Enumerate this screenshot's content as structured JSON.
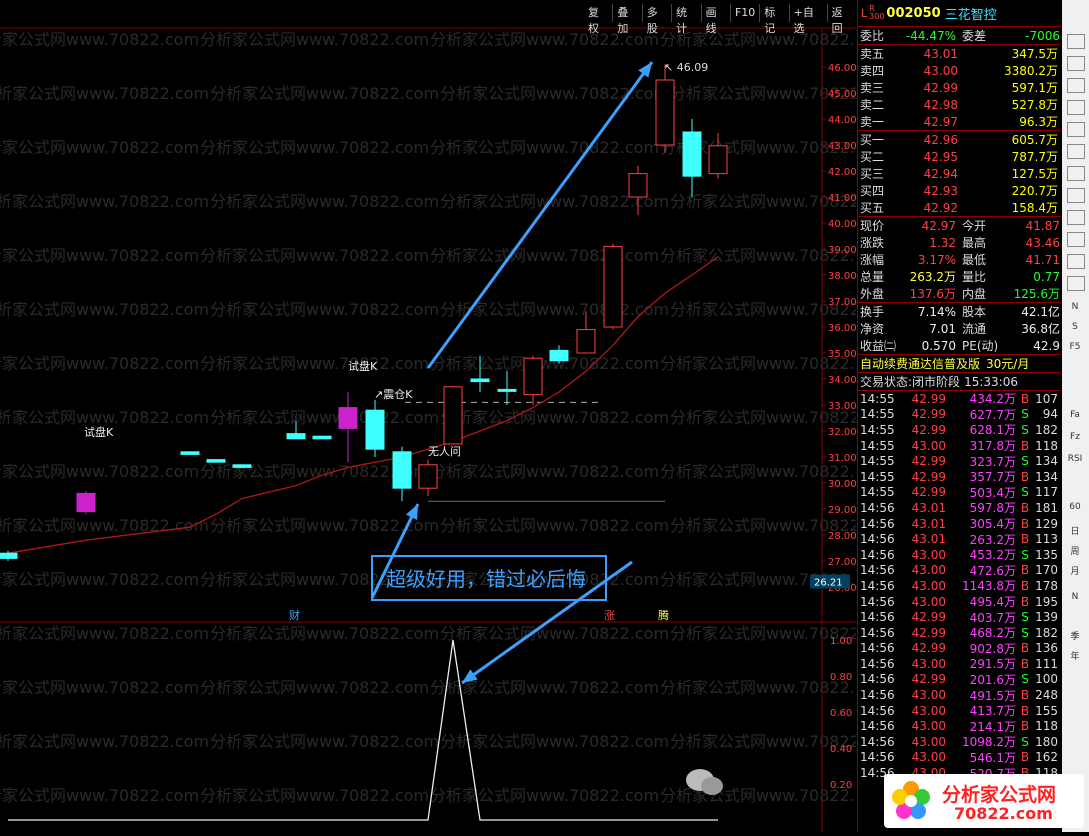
{
  "toolbar": [
    "复权",
    "叠加",
    "多股",
    "统计",
    "画线",
    "F10",
    "标记",
    "+自选",
    "返回"
  ],
  "chart": {
    "price_axis": [
      "46.00",
      "45.00",
      "44.00",
      "43.00",
      "42.00",
      "41.00",
      "40.00",
      "39.00",
      "38.00",
      "37.00",
      "36.00",
      "35.00",
      "34.00",
      "33.00",
      "32.00",
      "31.00",
      "30.00",
      "29.00",
      "28.00",
      "27.00",
      "26.00"
    ],
    "current_price_tag": "26.21",
    "high_marker": "46.09",
    "ind_axis": [
      "1.00",
      "0.80",
      "0.60",
      "0.40",
      "0.20"
    ],
    "labels": {
      "test_k1": "试盘K",
      "test_k2": "试盘K",
      "shakeout_k": "震仓K",
      "no_one_asks": "无人问",
      "cai": "财",
      "zhang": "涨",
      "teng": "腾"
    },
    "promo": "超级好用，错过必后悔",
    "watermark_text": "分析家公式网www.70822.com"
  },
  "chart_data": {
    "type": "candlestick",
    "candles": [
      {
        "o": 27.3,
        "c": 27.1,
        "h": 27.4,
        "l": 27.0,
        "up": false
      },
      {
        "o": 28.9,
        "c": 29.6,
        "h": 29.7,
        "l": 28.8,
        "up": true
      },
      {
        "o": 31.2,
        "c": 31.1,
        "h": 31.2,
        "l": 31.1,
        "up": false
      },
      {
        "o": 30.9,
        "c": 30.8,
        "h": 30.9,
        "l": 30.8,
        "up": false
      },
      {
        "o": 30.7,
        "c": 30.6,
        "h": 30.7,
        "l": 30.6,
        "up": false
      },
      {
        "o": 31.9,
        "c": 31.7,
        "h": 32.4,
        "l": 31.7,
        "up": false
      },
      {
        "o": 31.8,
        "c": 31.7,
        "h": 31.8,
        "l": 31.7,
        "up": false
      },
      {
        "o": 32.1,
        "c": 32.9,
        "h": 33.5,
        "l": 30.8,
        "up": true
      },
      {
        "o": 32.8,
        "c": 31.3,
        "h": 33.2,
        "l": 31.0,
        "up": false
      },
      {
        "o": 31.2,
        "c": 29.8,
        "h": 31.4,
        "l": 29.3,
        "up": false
      },
      {
        "o": 29.8,
        "c": 30.7,
        "h": 30.9,
        "l": 29.5,
        "up": true
      },
      {
        "o": 31.5,
        "c": 33.7,
        "h": 33.7,
        "l": 31.5,
        "up": true
      },
      {
        "o": 34.0,
        "c": 33.9,
        "h": 34.9,
        "l": 33.5,
        "up": false
      },
      {
        "o": 33.6,
        "c": 33.6,
        "h": 34.3,
        "l": 33.0,
        "up": false
      },
      {
        "o": 33.4,
        "c": 34.8,
        "h": 34.9,
        "l": 33.0,
        "up": true
      },
      {
        "o": 35.1,
        "c": 34.7,
        "h": 35.3,
        "l": 34.6,
        "up": false
      },
      {
        "o": 35.0,
        "c": 35.9,
        "h": 36.6,
        "l": 35.0,
        "up": true
      },
      {
        "o": 36.0,
        "c": 39.1,
        "h": 39.2,
        "l": 35.9,
        "up": true
      },
      {
        "o": 41.0,
        "c": 41.9,
        "h": 42.2,
        "l": 40.3,
        "up": true
      },
      {
        "o": 43.0,
        "c": 45.5,
        "h": 46.09,
        "l": 42.7,
        "up": true
      },
      {
        "o": 43.5,
        "c": 41.8,
        "h": 44.0,
        "l": 41.0,
        "up": false
      },
      {
        "o": 41.9,
        "c": 42.97,
        "h": 43.46,
        "l": 41.71,
        "up": true
      }
    ],
    "ma": [
      27.3,
      27.8,
      28.3,
      28.8,
      29.4,
      29.9,
      30.3,
      30.6,
      30.8,
      31.0,
      31.3,
      31.6,
      32.0,
      32.4,
      32.9,
      33.5,
      34.3,
      35.3,
      36.4,
      37.3,
      38.0,
      38.7
    ],
    "indicator": {
      "values": [
        0,
        0,
        0,
        0,
        0,
        0,
        0,
        0,
        0,
        0,
        0,
        1,
        0,
        0,
        0,
        0,
        0,
        0,
        0,
        0,
        0,
        0
      ],
      "ylim": [
        0,
        1
      ]
    }
  },
  "quote": {
    "code": "002050",
    "name": "三花智控",
    "weibi_label": "委比",
    "weibi": "-44.47%",
    "weicha_label": "委差",
    "weicha": "-7006",
    "asks": [
      {
        "label": "卖五",
        "price": "43.01",
        "vol": "347.5万"
      },
      {
        "label": "卖四",
        "price": "43.00",
        "vol": "3380.2万"
      },
      {
        "label": "卖三",
        "price": "42.99",
        "vol": "597.1万"
      },
      {
        "label": "卖二",
        "price": "42.98",
        "vol": "527.8万"
      },
      {
        "label": "卖一",
        "price": "42.97",
        "vol": "96.3万"
      }
    ],
    "bids": [
      {
        "label": "买一",
        "price": "42.96",
        "vol": "605.7万"
      },
      {
        "label": "买二",
        "price": "42.95",
        "vol": "787.7万"
      },
      {
        "label": "买三",
        "price": "42.94",
        "vol": "127.5万"
      },
      {
        "label": "买四",
        "price": "42.93",
        "vol": "220.7万"
      },
      {
        "label": "买五",
        "price": "42.92",
        "vol": "158.4万"
      }
    ],
    "stats1": [
      {
        "l1": "现价",
        "v1": "42.97",
        "c1": "red",
        "l2": "今开",
        "v2": "41.87",
        "c2": "red"
      },
      {
        "l1": "涨跌",
        "v1": "1.32",
        "c1": "red",
        "l2": "最高",
        "v2": "43.46",
        "c2": "red"
      },
      {
        "l1": "涨幅",
        "v1": "3.17%",
        "c1": "red",
        "l2": "最低",
        "v2": "41.71",
        "c2": "red"
      },
      {
        "l1": "总量",
        "v1": "263.2万",
        "c1": "yellow",
        "l2": "量比",
        "v2": "0.77",
        "c2": "green"
      },
      {
        "l1": "外盘",
        "v1": "137.6万",
        "c1": "red",
        "l2": "内盘",
        "v2": "125.6万",
        "c2": "green"
      }
    ],
    "stats2": [
      {
        "l1": "换手",
        "v1": "7.14%",
        "c1": "white",
        "l2": "股本",
        "v2": "42.1亿",
        "c2": "white"
      },
      {
        "l1": "净资",
        "v1": "7.01",
        "c1": "white",
        "l2": "流通",
        "v2": "36.8亿",
        "c2": "white"
      },
      {
        "l1": "收益㈡",
        "v1": "0.570",
        "c1": "white",
        "l2": "PE(动)",
        "v2": "42.9",
        "c2": "white"
      }
    ],
    "promo": "自动续费通达信普及版",
    "promo_price": "30元/月",
    "status_label": "交易状态:",
    "status": "闭市阶段",
    "status_time": "15:33:06",
    "ticks": [
      {
        "t": "14:55",
        "p": "42.99",
        "v": "434.2万",
        "bs": "B",
        "n": "107"
      },
      {
        "t": "14:55",
        "p": "42.99",
        "v": "627.7万",
        "bs": "S",
        "n": "94"
      },
      {
        "t": "14:55",
        "p": "42.99",
        "v": "628.1万",
        "bs": "S",
        "n": "182"
      },
      {
        "t": "14:55",
        "p": "43.00",
        "v": "317.8万",
        "bs": "B",
        "n": "118"
      },
      {
        "t": "14:55",
        "p": "42.99",
        "v": "323.7万",
        "bs": "S",
        "n": "134"
      },
      {
        "t": "14:55",
        "p": "42.99",
        "v": "357.7万",
        "bs": "B",
        "n": "134"
      },
      {
        "t": "14:55",
        "p": "42.99",
        "v": "503.4万",
        "bs": "S",
        "n": "117"
      },
      {
        "t": "14:56",
        "p": "43.01",
        "v": "597.8万",
        "bs": "B",
        "n": "181"
      },
      {
        "t": "14:56",
        "p": "43.01",
        "v": "305.4万",
        "bs": "B",
        "n": "129"
      },
      {
        "t": "14:56",
        "p": "43.01",
        "v": "263.2万",
        "bs": "B",
        "n": "113"
      },
      {
        "t": "14:56",
        "p": "43.00",
        "v": "453.2万",
        "bs": "S",
        "n": "135"
      },
      {
        "t": "14:56",
        "p": "43.00",
        "v": "472.6万",
        "bs": "B",
        "n": "170"
      },
      {
        "t": "14:56",
        "p": "43.00",
        "v": "1143.8万",
        "bs": "B",
        "n": "178"
      },
      {
        "t": "14:56",
        "p": "43.00",
        "v": "495.4万",
        "bs": "B",
        "n": "195"
      },
      {
        "t": "14:56",
        "p": "42.99",
        "v": "403.7万",
        "bs": "S",
        "n": "139"
      },
      {
        "t": "14:56",
        "p": "42.99",
        "v": "468.2万",
        "bs": "S",
        "n": "182"
      },
      {
        "t": "14:56",
        "p": "42.99",
        "v": "902.8万",
        "bs": "B",
        "n": "136"
      },
      {
        "t": "14:56",
        "p": "43.00",
        "v": "291.5万",
        "bs": "B",
        "n": "111"
      },
      {
        "t": "14:56",
        "p": "42.99",
        "v": "201.6万",
        "bs": "S",
        "n": "100"
      },
      {
        "t": "14:56",
        "p": "43.00",
        "v": "491.5万",
        "bs": "B",
        "n": "248"
      },
      {
        "t": "14:56",
        "p": "43.00",
        "v": "413.7万",
        "bs": "B",
        "n": "155"
      },
      {
        "t": "14:56",
        "p": "43.00",
        "v": "214.1万",
        "bs": "B",
        "n": "118"
      },
      {
        "t": "14:56",
        "p": "43.00",
        "v": "1098.2万",
        "bs": "S",
        "n": "180"
      },
      {
        "t": "14:56",
        "p": "43.00",
        "v": "546.1万",
        "bs": "B",
        "n": "162"
      },
      {
        "t": "14:56",
        "p": "43.00",
        "v": "520.7万",
        "bs": "B",
        "n": "118"
      }
    ]
  },
  "side_icons": [
    "N",
    "S",
    "F5",
    "Fa",
    "Fz",
    "RSI",
    "60",
    "日",
    "周",
    "月",
    "N",
    "季",
    "年"
  ],
  "logo_text": "分析家公式网",
  "logo_url": "70822.com"
}
